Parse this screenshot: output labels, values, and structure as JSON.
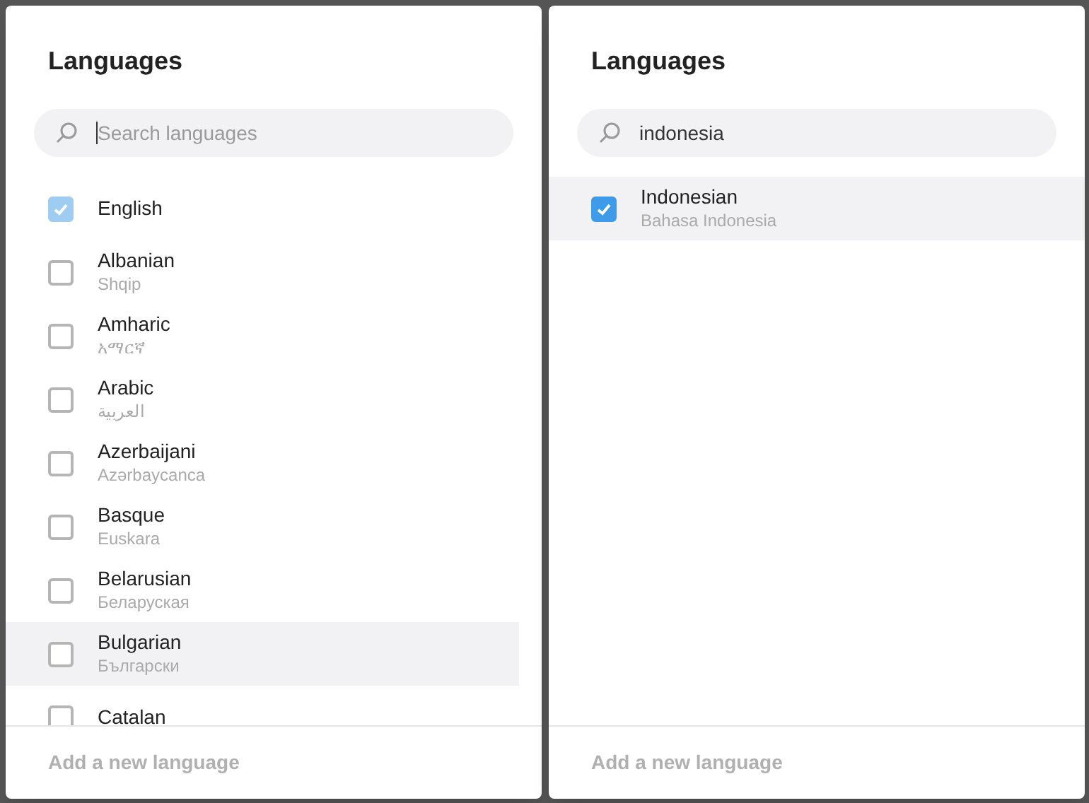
{
  "dialogs": [
    {
      "title": "Languages",
      "search": {
        "placeholder": "Search languages",
        "focused": true
      },
      "languages": [
        {
          "name": "English",
          "checked": true,
          "disabled": true,
          "highlighted": false
        },
        {
          "name": "Albanian",
          "native": "Shqip",
          "checked": false,
          "disabled": false,
          "highlighted": false
        },
        {
          "name": "Amharic",
          "native": "አማርኛ",
          "checked": false,
          "disabled": false,
          "highlighted": false
        },
        {
          "name": "Arabic",
          "native": "العربية",
          "checked": false,
          "disabled": false,
          "highlighted": false
        },
        {
          "name": "Azerbaijani",
          "native": "Azərbaycanca",
          "checked": false,
          "disabled": false,
          "highlighted": false
        },
        {
          "name": "Basque",
          "native": "Euskara",
          "checked": false,
          "disabled": false,
          "highlighted": false
        },
        {
          "name": "Belarusian",
          "native": "Беларуская",
          "checked": false,
          "disabled": false,
          "highlighted": false
        },
        {
          "name": "Bulgarian",
          "native": "Български",
          "checked": false,
          "disabled": false,
          "highlighted": true
        },
        {
          "name": "Catalan",
          "checked": false,
          "disabled": false,
          "highlighted": false
        }
      ],
      "footer": "Add a new language"
    },
    {
      "title": "Languages",
      "search": {
        "value": "indonesia",
        "focused": false
      },
      "languages": [
        {
          "name": "Indonesian",
          "native": "Bahasa Indonesia",
          "checked": true,
          "disabled": false,
          "highlighted": true
        }
      ],
      "footer": "Add a new language"
    }
  ]
}
